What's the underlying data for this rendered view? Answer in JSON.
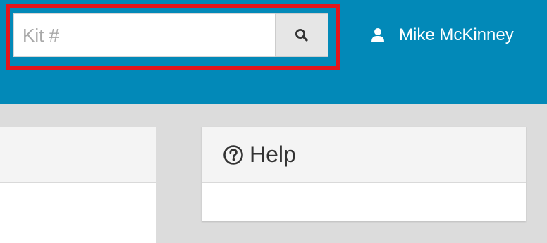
{
  "header": {
    "search": {
      "placeholder": "Kit #",
      "value": "",
      "button_icon": "search-icon"
    },
    "user": {
      "name": "Mike McKinney",
      "icon": "user-icon"
    },
    "highlight_color": "#e3161c",
    "background_color": "#0289b8"
  },
  "help_panel": {
    "title": "Help",
    "icon": "question-circle-icon"
  }
}
